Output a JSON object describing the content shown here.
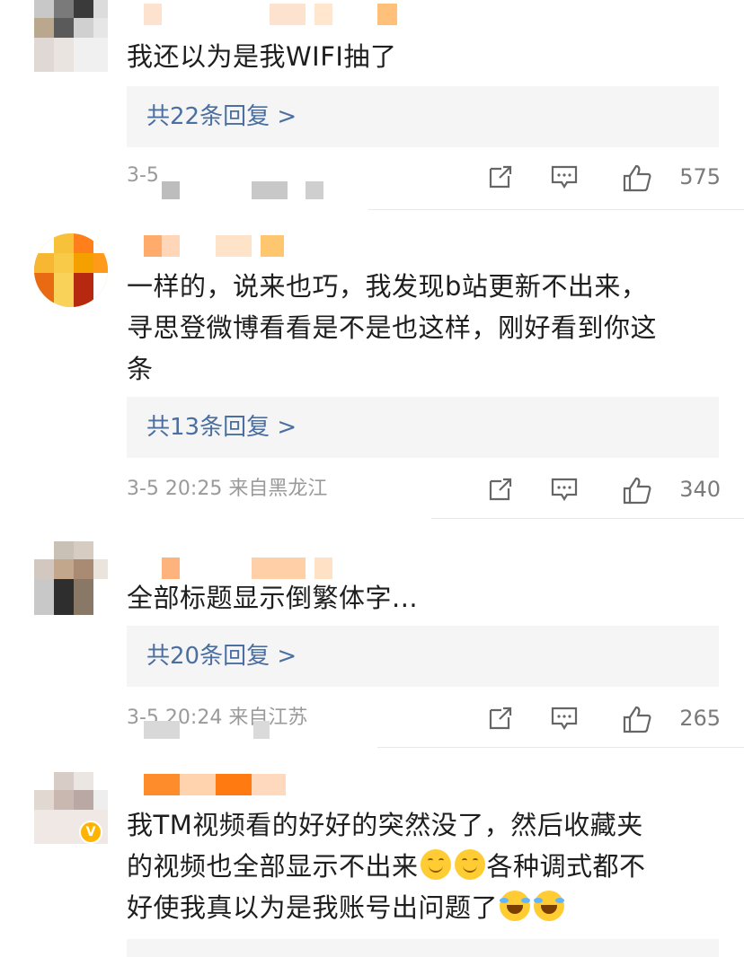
{
  "comments": [
    {
      "text": "我还以为是我WIFI抽了",
      "reply_label": "共22条回复 >",
      "meta": "3-5",
      "likes": "575"
    },
    {
      "text_lines": [
        "一样的，说来也巧，我发现b站更新不出来，",
        "寻思登微博看看是不是也这样，刚好看到你这",
        "条"
      ],
      "reply_label": "共13条回复 >",
      "meta": "3-5 20:25  来自黑龙江",
      "likes": "340"
    },
    {
      "text": "全部标题显示倒繁体字...",
      "reply_label": "共20条回复 >",
      "meta": "3-5 20:24  来自江苏",
      "likes": "265"
    },
    {
      "text_lines": [
        "我TM视频看的好好的突然没了，然后收藏夹",
        "的视频也全部显示不出来",
        "各种调式都不",
        "好使我真以为是我账号出问题了"
      ],
      "emojis_line2": [
        "smile-emoji",
        "smile-emoji"
      ],
      "emojis_line3": [
        "cry-laugh-emoji",
        "cry-laugh-emoji"
      ],
      "verified_badge": "V"
    }
  ],
  "colors": {
    "accent": "#4a6fa0",
    "name_orange": "#ff8200",
    "meta_gray": "#9a9a9a"
  },
  "icons": [
    "repost-icon",
    "comment-icon",
    "like-icon"
  ]
}
